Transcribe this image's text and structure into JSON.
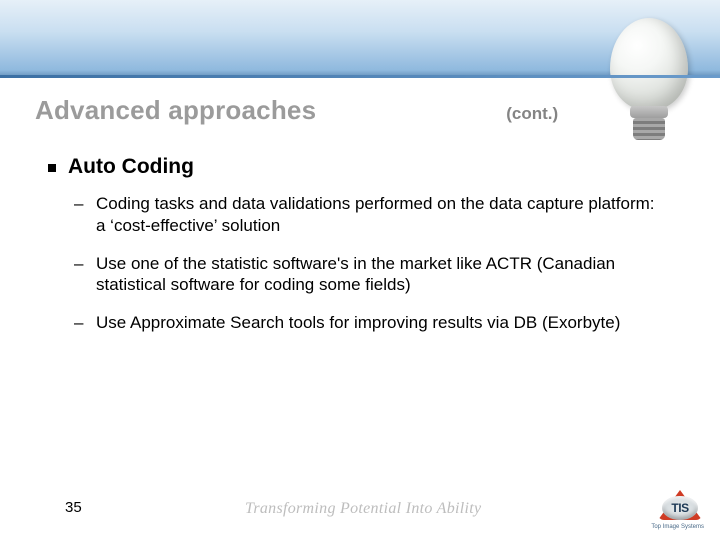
{
  "banner": {
    "decorative_image": "lightbulb"
  },
  "title": {
    "main": "Advanced approaches",
    "continuation": "(cont.)"
  },
  "section": {
    "heading": "Auto Coding",
    "items": [
      "Coding tasks and data validations performed on the data capture platform: a ‘cost-effective’ solution",
      "Use one of the statistic software's in the market like ACTR (Canadian statistical software for coding some fields)",
      "Use Approximate Search tools for improving results via DB (Exorbyte)"
    ]
  },
  "footer": {
    "page_number": "35",
    "tagline": "Transforming Potential Into Ability",
    "logo_text": "TIS",
    "logo_sub": "Top Image Systems"
  }
}
